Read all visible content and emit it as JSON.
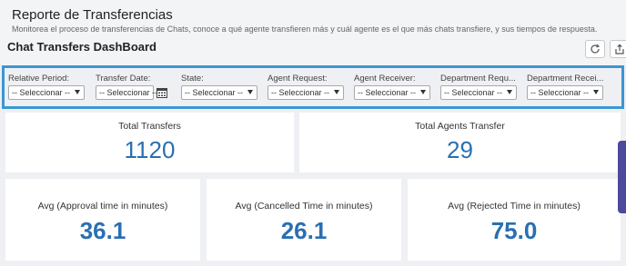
{
  "header": {
    "title": "Reporte de Transferencias",
    "subtitle": "Monitorea el proceso de transferencias de Chats, conoce a qué agente transfieren más y cuál agente es el que más chats transfiere, y sus tiempos de respuesta.",
    "dashboard_title": "Chat Transfers DashBoard",
    "refresh_icon": "refresh-icon",
    "share_icon": "share-icon"
  },
  "filters": [
    {
      "label": "Relative Period:",
      "value": "-- Seleccionar --"
    },
    {
      "label": "Transfer Date:",
      "value": "-- Seleccionar --"
    },
    {
      "label": "State:",
      "value": "-- Seleccionar --"
    },
    {
      "label": "Agent Request:",
      "value": "-- Seleccionar --"
    },
    {
      "label": "Agent Receiver:",
      "value": "-- Seleccionar --"
    },
    {
      "label": "Department Requ...",
      "value": "-- Seleccionar --"
    },
    {
      "label": "Department Recei...",
      "value": "-- Seleccionar --"
    }
  ],
  "kpis": {
    "total_transfers": {
      "label": "Total Transfers",
      "value": "1120"
    },
    "total_agents_transfer": {
      "label": "Total Agents Transfer",
      "value": "29"
    },
    "avg_approval": {
      "label": "Avg (Approval time in minutes)",
      "value": "36.1"
    },
    "avg_cancelled": {
      "label": "Avg (Cancelled Time in minutes)",
      "value": "26.1"
    },
    "avg_rejected": {
      "label": "Avg (Rejected Time in minutes)",
      "value": "75.0"
    }
  },
  "colors": {
    "accent": "#3b97d3",
    "value": "#2a6fb2",
    "side_tab": "#4d4a9e"
  }
}
